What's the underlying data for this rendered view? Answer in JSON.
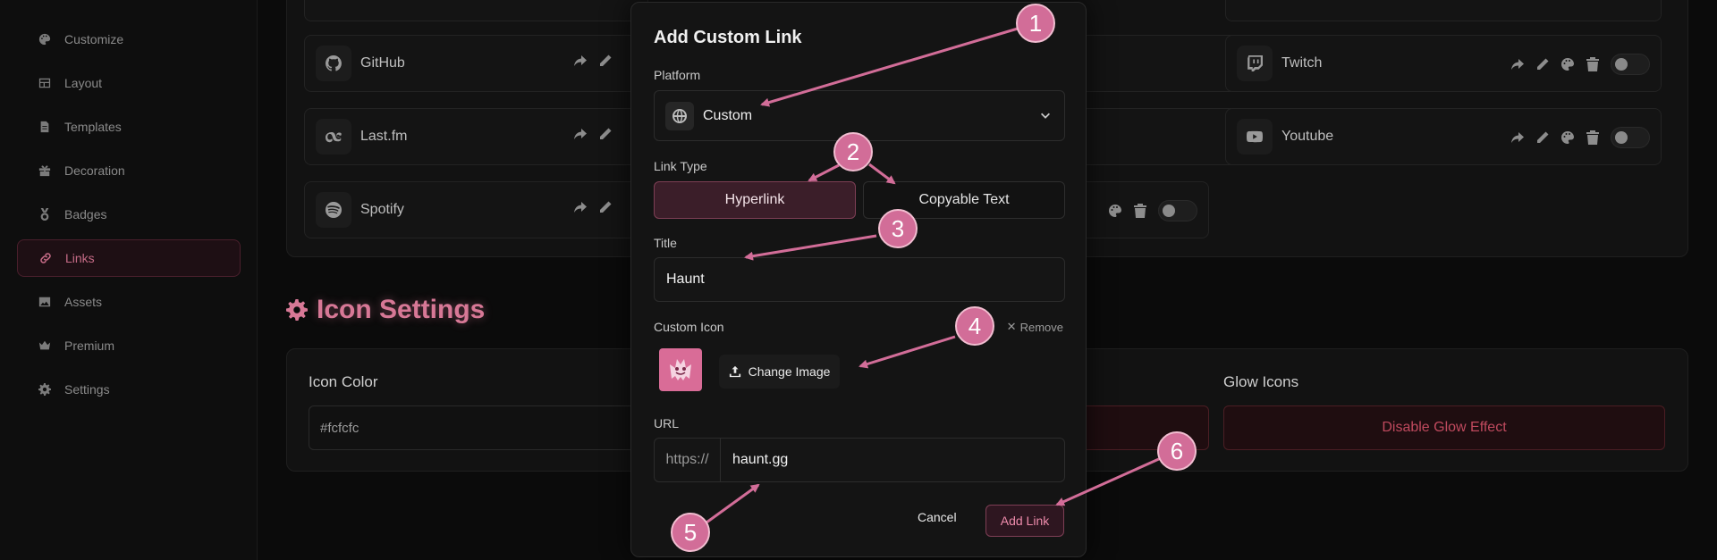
{
  "sidebar": {
    "items": [
      {
        "label": "Customize",
        "icon": "palette-icon"
      },
      {
        "label": "Layout",
        "icon": "layout-icon"
      },
      {
        "label": "Templates",
        "icon": "file-icon"
      },
      {
        "label": "Decoration",
        "icon": "gift-icon"
      },
      {
        "label": "Badges",
        "icon": "badge-icon"
      },
      {
        "label": "Links",
        "icon": "link-icon",
        "active": true
      },
      {
        "label": "Assets",
        "icon": "image-icon"
      },
      {
        "label": "Premium",
        "icon": "crown-icon"
      },
      {
        "label": "Settings",
        "icon": "gear-icon"
      }
    ]
  },
  "links": [
    {
      "name": "GitHub",
      "icon": "github-icon"
    },
    {
      "name": "Last.fm",
      "icon": "lastfm-icon"
    },
    {
      "name": "Spotify",
      "icon": "spotify-icon"
    },
    {
      "name": "Twitch",
      "icon": "twitch-icon"
    },
    {
      "name": "Youtube",
      "icon": "youtube-icon"
    }
  ],
  "icon_settings": {
    "title": "Icon Settings",
    "icon_color_label": "Icon Color",
    "icon_color_value": "#fcfcfc",
    "glow_label": "Glow Icons",
    "glow_button": "Disable Glow Effect"
  },
  "modal": {
    "title": "Add Custom Link",
    "platform_label": "Platform",
    "platform_value": "Custom",
    "link_type_label": "Link Type",
    "link_types": [
      "Hyperlink",
      "Copyable Text"
    ],
    "selected_link_type": "Hyperlink",
    "title_label": "Title",
    "title_value": "Haunt",
    "custom_icon_label": "Custom Icon",
    "remove_label": "Remove",
    "change_image_label": "Change Image",
    "url_label": "URL",
    "url_prefix": "https://",
    "url_value": "haunt.gg",
    "cancel_label": "Cancel",
    "add_label": "Add Link"
  },
  "annotations": [
    "1",
    "2",
    "3",
    "4",
    "5",
    "6"
  ],
  "colors": {
    "accent": "#d26d98",
    "danger": "#c04a5e"
  }
}
